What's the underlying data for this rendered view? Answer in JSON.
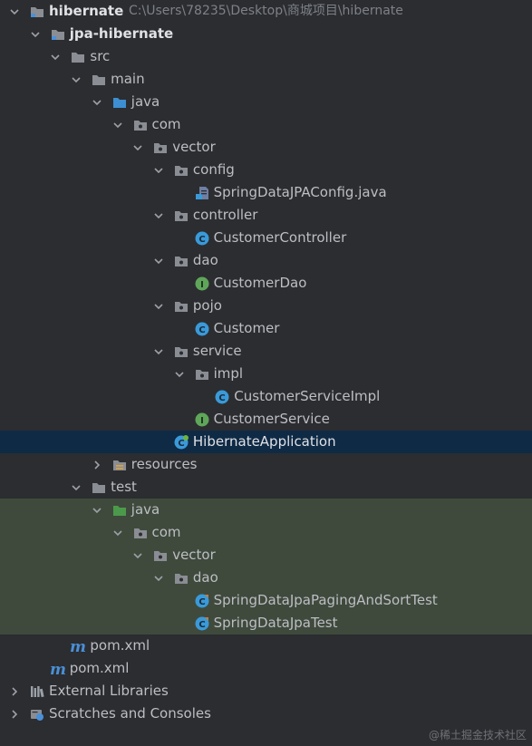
{
  "project_tree": {
    "root": {
      "label": "hibernate",
      "path": "C:\\Users\\78235\\Desktop\\商城项目\\hibernate"
    },
    "nodes": [
      {
        "label": "jpa-hibernate",
        "icon": "module-folder-icon",
        "expanded": true
      },
      {
        "label": "src",
        "icon": "folder-icon",
        "expanded": true
      },
      {
        "label": "main",
        "icon": "folder-icon",
        "expanded": true
      },
      {
        "label": "java",
        "icon": "source-root-folder-icon",
        "expanded": true
      },
      {
        "label": "com",
        "icon": "package-icon",
        "expanded": true
      },
      {
        "label": "vector",
        "icon": "package-icon",
        "expanded": true
      },
      {
        "label": "config",
        "icon": "package-icon",
        "expanded": true
      },
      {
        "label": "SpringDataJPAConfig.java",
        "icon": "java-file-icon"
      },
      {
        "label": "controller",
        "icon": "package-icon",
        "expanded": true
      },
      {
        "label": "CustomerController",
        "icon": "class-icon"
      },
      {
        "label": "dao",
        "icon": "package-icon",
        "expanded": true
      },
      {
        "label": "CustomerDao",
        "icon": "interface-icon"
      },
      {
        "label": "pojo",
        "icon": "package-icon",
        "expanded": true
      },
      {
        "label": "Customer",
        "icon": "class-icon"
      },
      {
        "label": "service",
        "icon": "package-icon",
        "expanded": true
      },
      {
        "label": "impl",
        "icon": "package-icon",
        "expanded": true
      },
      {
        "label": "CustomerServiceImpl",
        "icon": "class-icon"
      },
      {
        "label": "CustomerService",
        "icon": "interface-icon"
      },
      {
        "label": "HibernateApplication",
        "icon": "spring-boot-class-icon",
        "selected": true
      },
      {
        "label": "resources",
        "icon": "resources-folder-icon",
        "expanded": false
      },
      {
        "label": "test",
        "icon": "folder-icon",
        "expanded": true
      },
      {
        "label": "java",
        "icon": "test-source-folder-icon",
        "expanded": true
      },
      {
        "label": "com",
        "icon": "package-icon",
        "expanded": true
      },
      {
        "label": "vector",
        "icon": "package-icon",
        "expanded": true
      },
      {
        "label": "dao",
        "icon": "package-icon",
        "expanded": true
      },
      {
        "label": "SpringDataJpaPagingAndSortTest",
        "icon": "test-class-icon"
      },
      {
        "label": "SpringDataJpaTest",
        "icon": "test-class-icon"
      },
      {
        "label": "pom.xml",
        "icon": "maven-icon"
      },
      {
        "label": "pom.xml",
        "icon": "maven-icon"
      },
      {
        "label": "External Libraries",
        "icon": "libraries-icon",
        "expanded": false
      },
      {
        "label": "Scratches and Consoles",
        "icon": "scratches-icon",
        "expanded": false
      }
    ]
  },
  "colors": {
    "background": "#2b2d30",
    "selection": "#0f2a45",
    "test_highlight": "#3f4a3c",
    "folder": "#8a8d93",
    "source_root": "#3d8fd1",
    "test_root": "#4b9a4b",
    "class": "#3a9ad9",
    "interface": "#5fa65a",
    "maven": "#4a8fd6"
  },
  "watermark": "@稀土掘金技术社区"
}
